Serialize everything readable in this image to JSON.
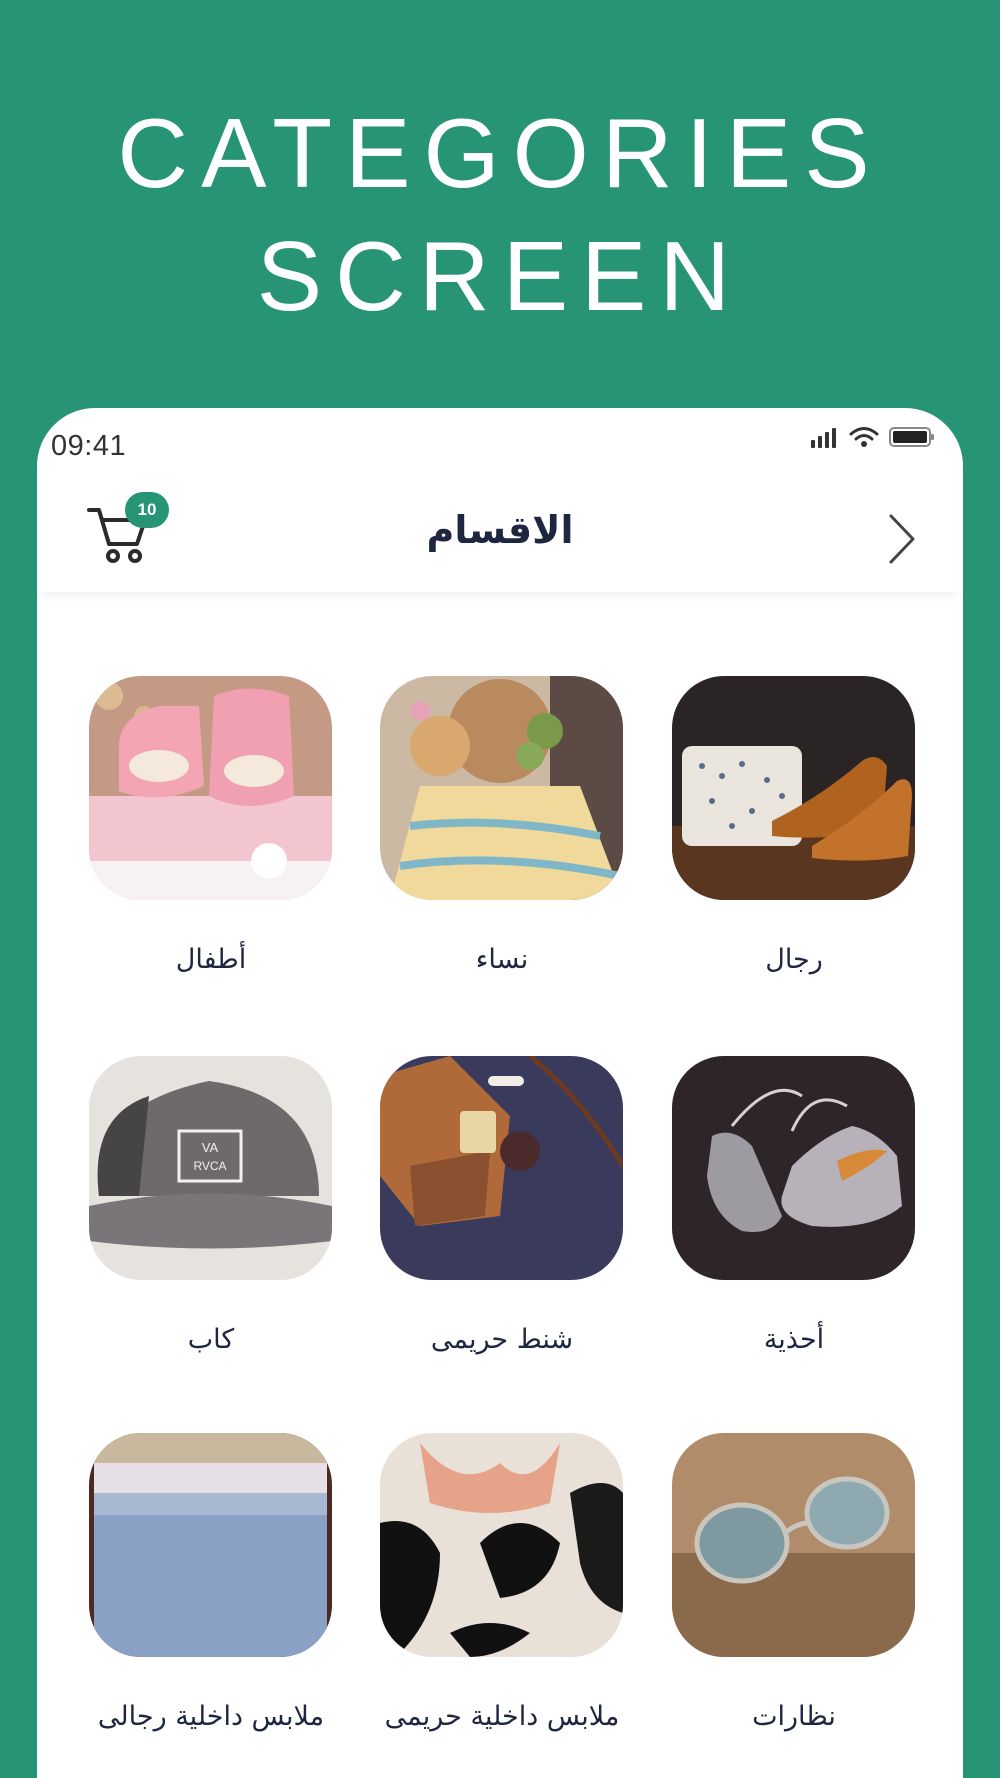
{
  "hero": {
    "line1": "CATEGORIES",
    "line2": "SCREEN"
  },
  "status": {
    "time": "09:41"
  },
  "header": {
    "title": "الاقسام",
    "cart_count": "10"
  },
  "categories": [
    {
      "label": "رجال"
    },
    {
      "label": "نساء"
    },
    {
      "label": "أطفال"
    },
    {
      "label": "أحذية"
    },
    {
      "label": "شنط حريمى"
    },
    {
      "label": "كاب"
    },
    {
      "label": "نظارات"
    },
    {
      "label": "ملابس داخلية حريمى"
    },
    {
      "label": "ملابس داخلية رجالى"
    }
  ],
  "colors": {
    "brand": "#279476",
    "title": "#1e2640"
  }
}
